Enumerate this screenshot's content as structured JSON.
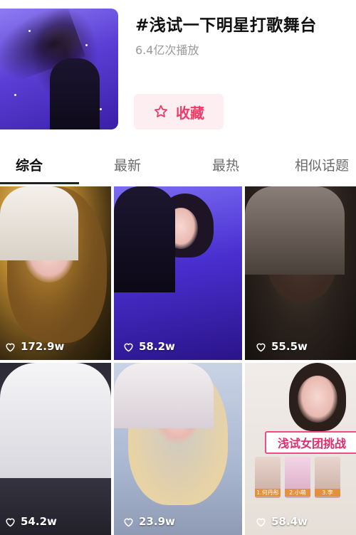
{
  "topic": {
    "title": "#浅试一下明星打歌舞台",
    "plays": "6.4亿次播放",
    "favorite_label": "收藏"
  },
  "tabs": [
    {
      "label": "综合",
      "active": true
    },
    {
      "label": "最新",
      "active": false
    },
    {
      "label": "最热",
      "active": false
    },
    {
      "label": "相似话题",
      "active": false
    }
  ],
  "videos": [
    {
      "likes": "172.9w"
    },
    {
      "likes": "58.2w"
    },
    {
      "likes": "55.5w"
    },
    {
      "likes": "54.2w"
    },
    {
      "likes": "23.9w"
    },
    {
      "likes": "58.4w",
      "banner": "浅试女团挑战",
      "sub_labels": [
        "1.何丹彤",
        "2.小萌",
        "3.李"
      ]
    }
  ],
  "colors": {
    "accent": "#f03a68",
    "fav_bg": "#fdeef1",
    "text_primary": "#111111",
    "text_secondary": "#9a9a9a"
  }
}
